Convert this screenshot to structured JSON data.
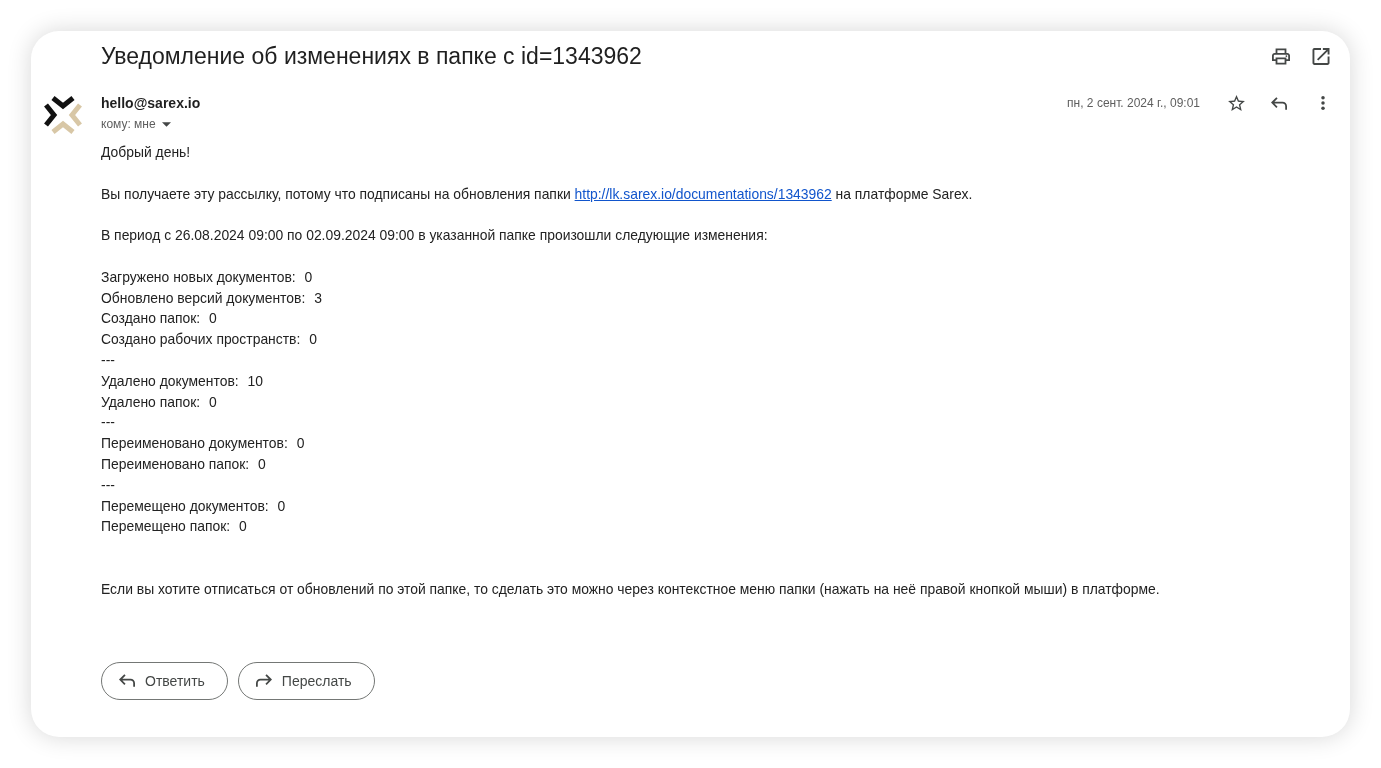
{
  "message": {
    "subject": "Уведомление об изменениях в папке с id=1343962",
    "sender": "hello@sarex.io",
    "recipient": "кому: мне",
    "date": "пн, 2 сент. 2024 г., 09:01",
    "starred": false,
    "body": {
      "greeting": "Добрый день!",
      "subscription": {
        "before": "Вы получаете эту рассылку, потому что подписаны на обновления папки",
        "link": "http://lk.sarex.io/documentations/1343962",
        "after": "на платформе Sarex."
      },
      "period": "В период с 26.08.2024 09:00 по 02.09.2024 09:00 в указанной папке произошли следующие изменения:",
      "changes": [
        {
          "kind": "stat",
          "label": "Загружено новых документов:",
          "value": "0"
        },
        {
          "kind": "stat",
          "label": "Обновлено версий документов:",
          "value": "3"
        },
        {
          "kind": "stat",
          "label": "Создано папок:",
          "value": "0"
        },
        {
          "kind": "stat",
          "label": "Создано рабочих пространств:",
          "value": "0"
        },
        {
          "kind": "separator",
          "text": "---"
        },
        {
          "kind": "stat",
          "label": "Удалено документов:",
          "value": "10"
        },
        {
          "kind": "stat",
          "label": "Удалено папок:",
          "value": "0"
        },
        {
          "kind": "separator",
          "text": "---"
        },
        {
          "kind": "stat",
          "label": "Переименовано документов:",
          "value": "0"
        },
        {
          "kind": "stat",
          "label": "Переименовано папок:",
          "value": "0"
        },
        {
          "kind": "separator",
          "text": "---"
        },
        {
          "kind": "stat",
          "label": "Перемещено документов:",
          "value": "0"
        },
        {
          "kind": "stat",
          "label": "Перемещено папок:",
          "value": "0"
        }
      ],
      "unsubscribe": "Если вы хотите отписаться от обновлений по этой папке, то сделать это можно через контекстное меню папки (нажать на неё правой кнопкой мыши) в платформе."
    },
    "actions": [
      {
        "kind": "reply",
        "label": "Ответить"
      },
      {
        "kind": "forward",
        "label": "Переслать"
      }
    ]
  }
}
